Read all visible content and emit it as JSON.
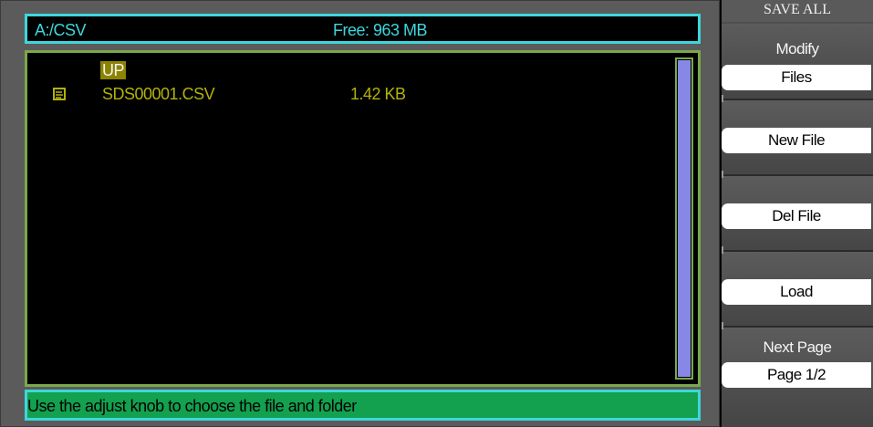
{
  "header": {
    "path": "A:/CSV",
    "free_space": "Free: 963 MB"
  },
  "file_browser": {
    "up_label": "UP",
    "files": [
      {
        "name": "SDS00001.CSV",
        "size": "1.42 KB",
        "icon": "file-icon"
      }
    ]
  },
  "status": {
    "message": "Use the adjust knob to choose the file and folder"
  },
  "menu": {
    "title": "SAVE ALL",
    "modify": {
      "title": "Modify",
      "value": "Files"
    },
    "new_file": {
      "value": "New File"
    },
    "del_file": {
      "value": "Del File"
    },
    "load": {
      "value": "Load"
    },
    "next_page": {
      "title": "Next Page",
      "value": "Page 1/2"
    }
  },
  "colors": {
    "accent_cyan": "#3ed6dc",
    "file_text": "#b2b20a",
    "status_green": "#13a14f",
    "scroll_thumb": "#8787e6",
    "browser_border": "#7aa84a"
  }
}
